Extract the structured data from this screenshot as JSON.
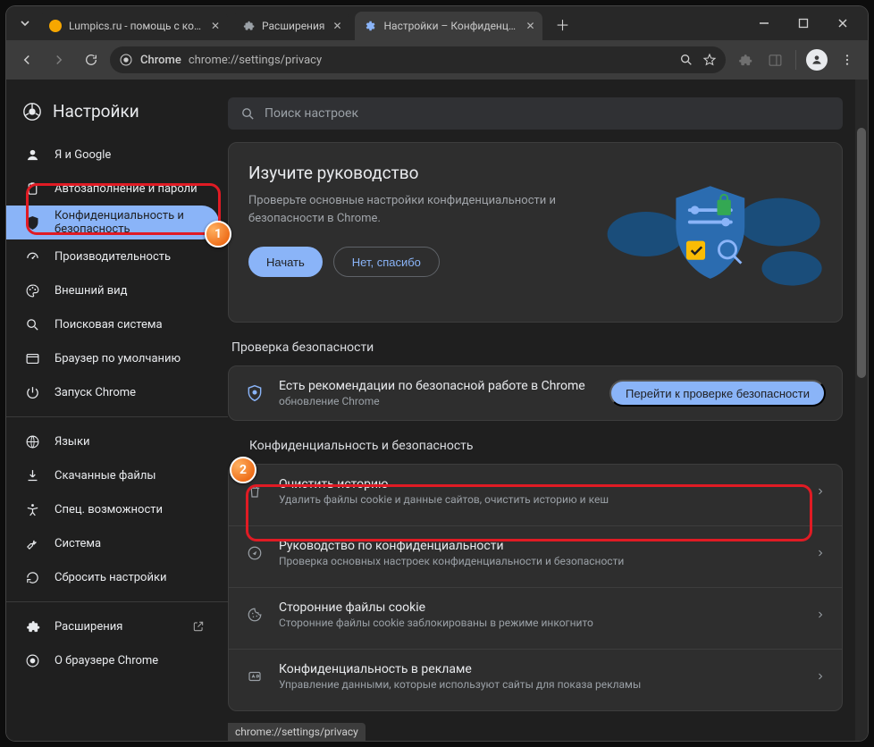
{
  "tabs": [
    {
      "label": "Lumpics.ru - помощь с комп",
      "favicon": "#f7a700"
    },
    {
      "label": "Расширения",
      "favicon": "#9aa0a6"
    },
    {
      "label": "Настройки – Конфиденциа",
      "favicon": "#8ab4f8",
      "active": true
    }
  ],
  "address": {
    "site": "Chrome",
    "url": "chrome://settings/privacy"
  },
  "settings_title": "Настройки",
  "search_placeholder": "Поиск настроек",
  "sidebar": {
    "items": [
      {
        "id": "you",
        "label": "Я и Google",
        "icon": "person"
      },
      {
        "id": "autofill",
        "label": "Автозаполнение и пароли",
        "icon": "clipboard"
      },
      {
        "id": "privacy",
        "label": "Конфиденциальность и безопасность",
        "icon": "shield",
        "selected": true
      },
      {
        "id": "performance",
        "label": "Производительность",
        "icon": "speed"
      },
      {
        "id": "appearance",
        "label": "Внешний вид",
        "icon": "palette"
      },
      {
        "id": "search",
        "label": "Поисковая система",
        "icon": "search"
      },
      {
        "id": "default",
        "label": "Браузер по умолчанию",
        "icon": "browser"
      },
      {
        "id": "startup",
        "label": "Запуск Chrome",
        "icon": "power"
      }
    ],
    "more": [
      {
        "id": "languages",
        "label": "Языки",
        "icon": "globe"
      },
      {
        "id": "downloads",
        "label": "Скачанные файлы",
        "icon": "download"
      },
      {
        "id": "accessibility",
        "label": "Спец. возможности",
        "icon": "accessibility"
      },
      {
        "id": "system",
        "label": "Система",
        "icon": "wrench"
      },
      {
        "id": "reset",
        "label": "Сбросить настройки",
        "icon": "reset"
      }
    ],
    "footer": [
      {
        "id": "extensions",
        "label": "Расширения",
        "icon": "puzzle",
        "external": true
      },
      {
        "id": "about",
        "label": "О браузере Chrome",
        "icon": "chrome"
      }
    ]
  },
  "guide": {
    "title": "Изучите руководство",
    "desc": "Проверьте основные настройки конфиденциальности и безопасности в Chrome.",
    "primary": "Начать",
    "secondary": "Нет, спасибо"
  },
  "safety_check": {
    "heading": "Проверка безопасности",
    "title": "Есть рекомендации по безопасной работе в Chrome",
    "sub": "обновление Chrome",
    "action": "Перейти к проверке безопасности"
  },
  "privacy_section": {
    "heading": "Конфиденциальность и безопасность",
    "rows": [
      {
        "icon": "trash",
        "title": "Очистить историю",
        "sub": "Удалить файлы cookie и данные сайтов, очистить историю и кеш"
      },
      {
        "icon": "compass",
        "title": "Руководство по конфиденциальности",
        "sub": "Проверка основных настроек конфиденциальности и безопасности"
      },
      {
        "icon": "cookie",
        "title": "Сторонние файлы cookie",
        "sub": "Сторонние файлы cookie заблокированы в режиме инкогнито"
      },
      {
        "icon": "ads",
        "title": "Конфиденциальность в рекламе",
        "sub": "Управление данными, которые используют сайты для показа рекламы"
      }
    ]
  },
  "status_url": "chrome://settings/privacy",
  "annotations": {
    "badge1": "1",
    "badge2": "2"
  }
}
